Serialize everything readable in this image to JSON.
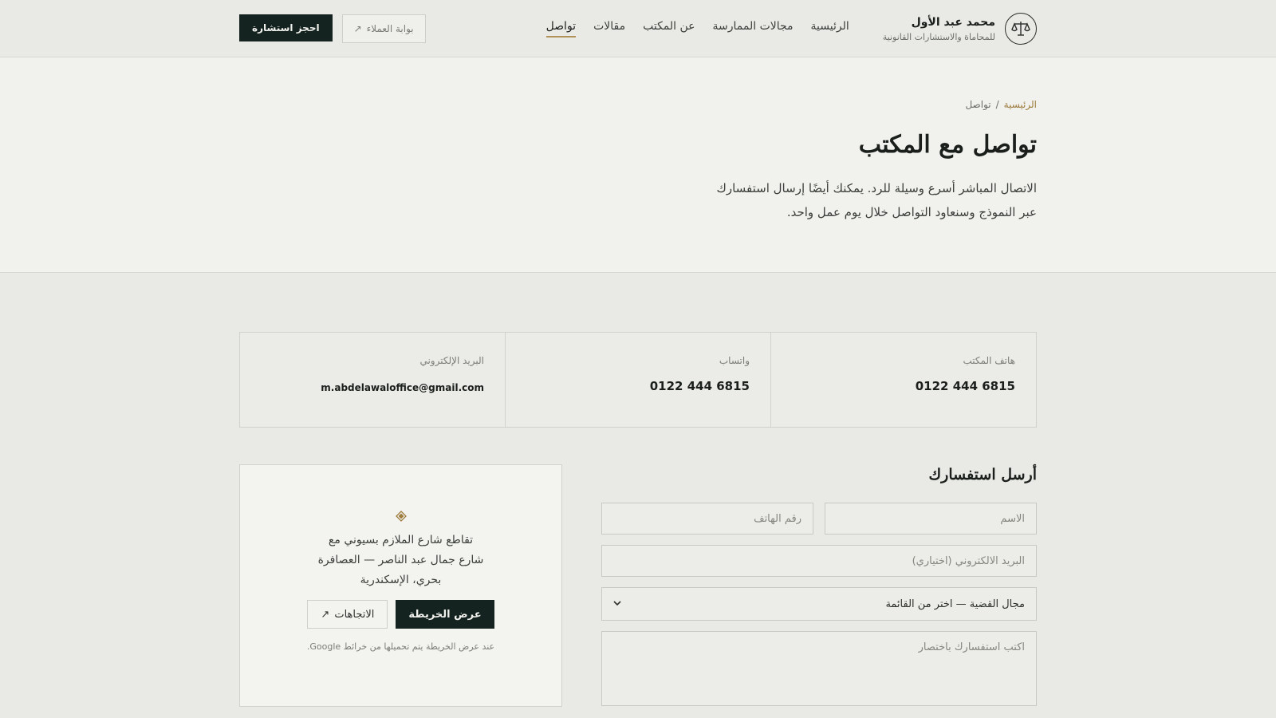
{
  "header": {
    "brand_name": "محمد عبد الأول",
    "brand_sub": "للمحاماة والاستشارات القانونية",
    "nav": [
      {
        "label": "الرئيسية"
      },
      {
        "label": "مجالات الممارسة"
      },
      {
        "label": "عن المكتب"
      },
      {
        "label": "مقالات"
      },
      {
        "label": "تواصل"
      }
    ],
    "client_portal": "بوابة العملاء",
    "book_consultation": "احجز استشارة"
  },
  "hero": {
    "breadcrumb_home": "الرئيسية",
    "breadcrumb_sep": "/",
    "breadcrumb_current": "تواصل",
    "title": "تواصل مع المكتب",
    "lead": "الاتصال المباشر أسرع وسيلة للرد. يمكنك أيضًا إرسال استفسارك عبر النموذج وسنعاود التواصل خلال يوم عمل واحد."
  },
  "contact": [
    {
      "label": "هاتف المكتب",
      "value": "0122 444 6815"
    },
    {
      "label": "واتساب",
      "value": "0122 444 6815"
    },
    {
      "label": "البريد الإلكتروني",
      "value": "m.abdelawaloffice@gmail.com"
    }
  ],
  "form": {
    "title": "أرسل استفسارك",
    "name_placeholder": "الاسم",
    "phone_placeholder": "رقم الهاتف",
    "email_placeholder": "البريد الالكتروني (اختياري)",
    "case_select": "مجال القضية — اختر من القائمة",
    "message_placeholder": "اكتب استفسارك باختصار"
  },
  "map": {
    "address": "تقاطع شارع الملازم بسيوني مع شارع جمال عبد الناصر — العصافرة بحري، الإسكندرية",
    "show_map": "عرض الخريطة",
    "directions": "الاتجاهات",
    "note": "عند عرض الخريطة يتم تحميلها من خرائط Google."
  },
  "colors": {
    "accent": "#b29256",
    "dark": "#142320",
    "background": "#e9e9e5"
  }
}
